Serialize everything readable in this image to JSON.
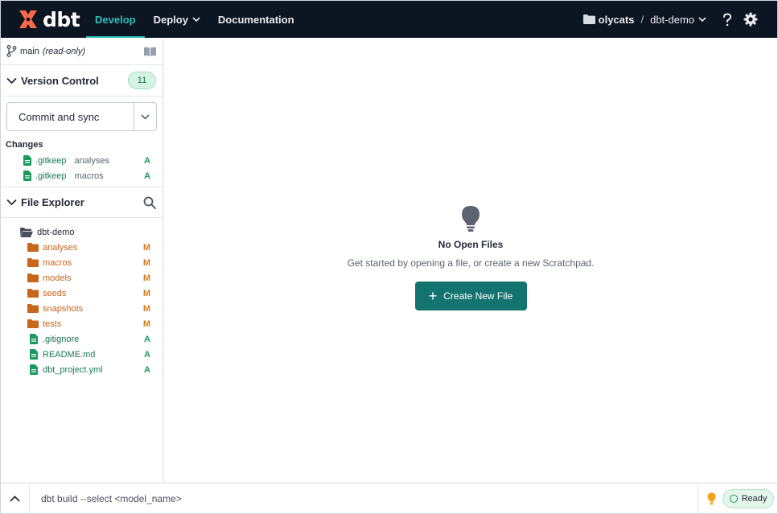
{
  "topnav": {
    "logo_text": "dbt",
    "tabs": [
      {
        "label": "Develop"
      },
      {
        "label": "Deploy"
      },
      {
        "label": "Documentation"
      }
    ],
    "account": "olycats",
    "separator": "/",
    "project": "dbt-demo",
    "accent_color": "#2fbfbd",
    "bg_color": "#0c1522"
  },
  "sidebar": {
    "branch": {
      "name": "main",
      "status": "(read-only)"
    },
    "version_control": {
      "title": "Version Control",
      "count": "11",
      "commit_label": "Commit and sync",
      "changes_label": "Changes",
      "changes": [
        {
          "file": ".gitkeep",
          "dir": "analyses",
          "flag": "A"
        },
        {
          "file": ".gitkeep",
          "dir": "macros",
          "flag": "A"
        }
      ]
    },
    "file_explorer": {
      "title": "File Explorer",
      "root": "dbt-demo",
      "items": [
        {
          "name": "analyses",
          "type": "folder",
          "flag": "M"
        },
        {
          "name": "macros",
          "type": "folder",
          "flag": "M"
        },
        {
          "name": "models",
          "type": "folder",
          "flag": "M"
        },
        {
          "name": "seeds",
          "type": "folder",
          "flag": "M"
        },
        {
          "name": "snapshots",
          "type": "folder",
          "flag": "M"
        },
        {
          "name": "tests",
          "type": "folder",
          "flag": "M"
        },
        {
          "name": ".gitignore",
          "type": "file",
          "flag": "A"
        },
        {
          "name": "README.md",
          "type": "file",
          "flag": "A"
        },
        {
          "name": "dbt_project.yml",
          "type": "file",
          "flag": "A"
        }
      ]
    }
  },
  "main": {
    "empty_title": "No Open Files",
    "empty_subtitle": "Get started by opening a file, or create a new Scratchpad.",
    "create_button": "Create New File",
    "button_color": "#12736f"
  },
  "bottombar": {
    "command": "dbt build --select <model_name>",
    "status": "Ready"
  }
}
